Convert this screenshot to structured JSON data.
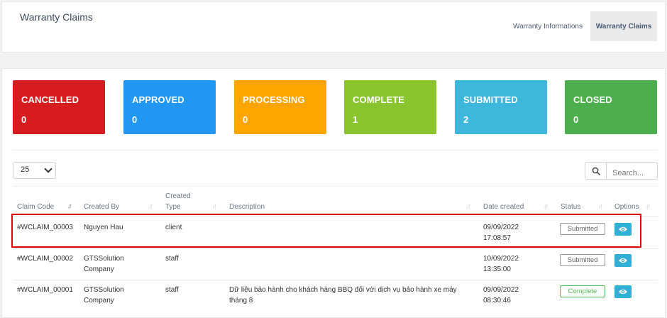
{
  "header": {
    "title": "Warranty Claims",
    "tabs": [
      {
        "label": "Warranty Informations",
        "active": false
      },
      {
        "label": "Warranty Claims",
        "active": true
      }
    ]
  },
  "summary_cards": [
    {
      "label": "CANCELLED",
      "count": "0",
      "color": "#d71c1f"
    },
    {
      "label": "APPROVED",
      "count": "0",
      "color": "#2196f3"
    },
    {
      "label": "PROCESSING",
      "count": "0",
      "color": "#ffa501"
    },
    {
      "label": "COMPLETE",
      "count": "1",
      "color": "#8ac42e"
    },
    {
      "label": "SUBMITTED",
      "count": "2",
      "color": "#3db8dc"
    },
    {
      "label": "CLOSED",
      "count": "0",
      "color": "#4cae4c"
    }
  ],
  "table_controls": {
    "page_size": "25",
    "search_placeholder": "Search...",
    "search_icon": "search-icon"
  },
  "table": {
    "columns": [
      "Claim Code",
      "Created By",
      "Created Type",
      "Description",
      "Date created",
      "Status",
      "Options"
    ],
    "columns_split": {
      "created_type_1": "Created",
      "created_type_2": "Type"
    },
    "rows": [
      {
        "claim_code": "#WCLAIM_00003",
        "created_by": [
          "Nguyen Hau"
        ],
        "created_type": "client",
        "description": "",
        "date": "09/09/2022",
        "time": "17:08:57",
        "status": "Submitted",
        "option_icon": "eye-icon"
      },
      {
        "claim_code": "#WCLAIM_00002",
        "created_by": [
          "GTSSolution",
          "Company"
        ],
        "created_type": "staff",
        "description": "",
        "date": "10/09/2022",
        "time": "13:35:00",
        "status": "Submitted",
        "option_icon": "eye-icon"
      },
      {
        "claim_code": "#WCLAIM_00001",
        "created_by": [
          "GTSSolution",
          "Company"
        ],
        "created_type": "staff",
        "description": [
          "Dữ liệu bảo hành cho khách hàng BBQ đối với dịch vụ bảo hành xe máy",
          "tháng 8"
        ],
        "date": "09/09/2022",
        "time": "08:30:46",
        "status": "Complete",
        "option_icon": "eye-icon"
      }
    ]
  },
  "colors": {
    "highlight_border": "#e00000",
    "view_button": "#31b0d5",
    "status_complete": "#5cb85c"
  }
}
